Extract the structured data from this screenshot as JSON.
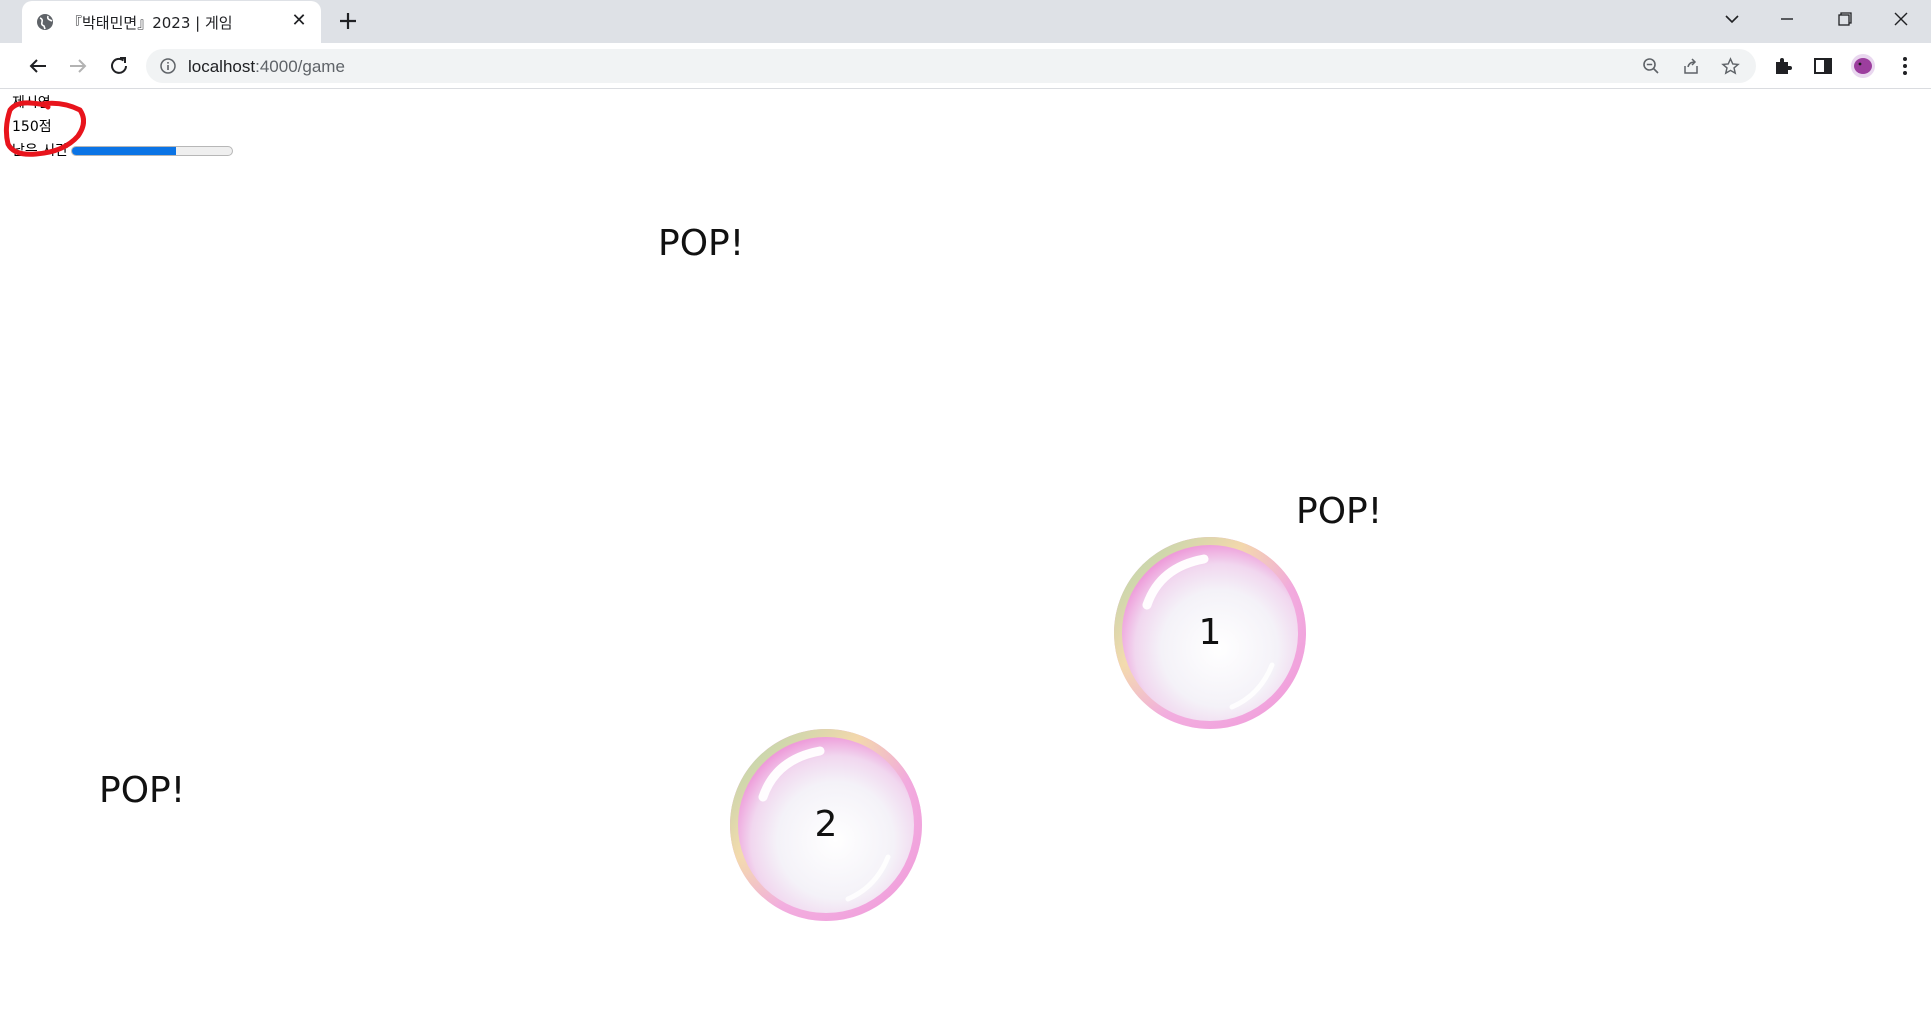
{
  "browser": {
    "tab_title": "『박태민면』2023 | 게임",
    "url_host": "localhost",
    "url_path": ":4000/game"
  },
  "hud": {
    "player_name": "제시연",
    "score": "150점",
    "time_label": "남은 시간",
    "time_remaining_fraction": 0.65
  },
  "game": {
    "pop_text": "POP!",
    "bubbles": [
      {
        "number": "1"
      },
      {
        "number": "2"
      }
    ]
  },
  "colors": {
    "progress_fill": "#0b74e5",
    "annotation_circle": "#e8141c"
  }
}
